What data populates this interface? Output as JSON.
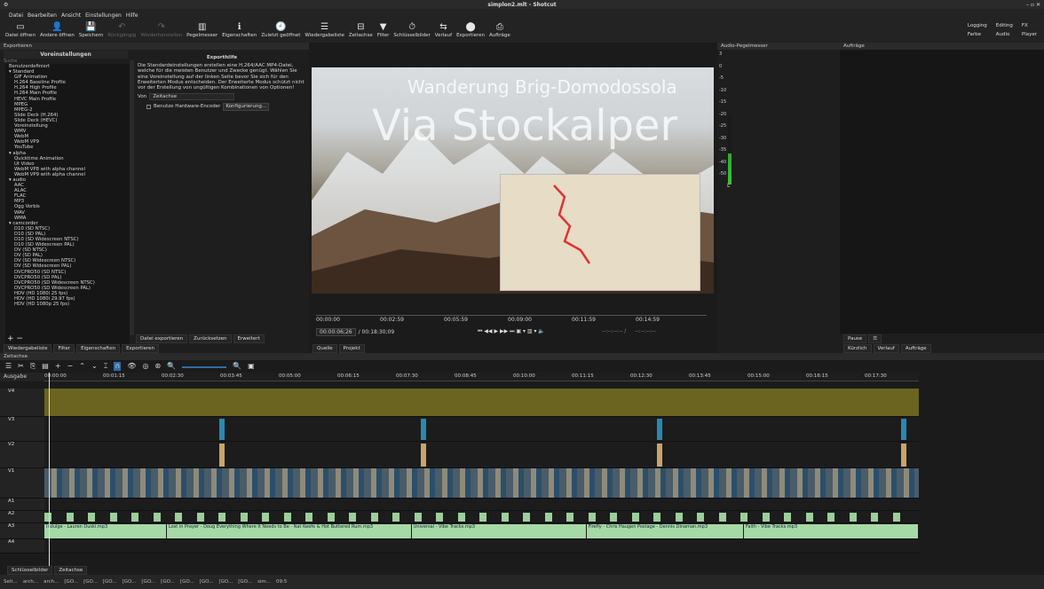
{
  "window": {
    "title": "simplon2.mlt - Shotcut",
    "left_glyph": "⚙",
    "controls": "– ▫ ✕"
  },
  "menu": [
    "Datei",
    "Bearbeiten",
    "Ansicht",
    "Einstellungen",
    "Hilfe"
  ],
  "toolbar": [
    {
      "icon": "▭",
      "label": "Datei öffnen"
    },
    {
      "icon": "👤",
      "label": "Andere öffnen"
    },
    {
      "icon": "💾",
      "label": "Speichern"
    },
    {
      "icon": "↶",
      "label": "Rückgängig",
      "dim": true
    },
    {
      "icon": "↷",
      "label": "Wiederherstellen",
      "dim": true
    },
    {
      "icon": "▥",
      "label": "Pegelmesser"
    },
    {
      "icon": "ℹ",
      "label": "Eigenschaften"
    },
    {
      "icon": "🕘",
      "label": "Zuletzt geöffnet"
    },
    {
      "icon": "☰",
      "label": "Wiedergabeliste"
    },
    {
      "icon": "⊟",
      "label": "Zeitachse"
    },
    {
      "icon": "▼",
      "label": "Filter"
    },
    {
      "icon": "⏱",
      "label": "Schlüsselbilder"
    },
    {
      "icon": "⇆",
      "label": "Verlauf"
    },
    {
      "icon": "⬤",
      "label": "Exportieren"
    },
    {
      "icon": "⎙",
      "label": "Aufträge"
    }
  ],
  "layouts": [
    "Logging",
    "Editing",
    "FX",
    "Farbe",
    "Audio",
    "Player"
  ],
  "export": {
    "panel_title": "Exportieren",
    "presets_title": "Voreinstellungen",
    "search_placeholder": "Suche",
    "presets": [
      "Benutzerdefiniert",
      "▾ Standard",
      "GIF Animation",
      "H.264 Baseline Profile",
      "H.264 High Profile",
      "H.264 Main Profile",
      "HEVC Main Profile",
      "MPEG",
      "MPEG-2",
      "Slide Deck (H.264)",
      "Slide Deck (HEVC)",
      "Voreinstellung",
      "WMV",
      "WebM",
      "WebM VP9",
      "YouTube",
      "▾ alpha",
      "Quicktime Animation",
      "Ut Video",
      "WebM VP8 with alpha channel",
      "WebM VP9 with alpha channel",
      "▾ audio",
      "AAC",
      "ALAC",
      "FLAC",
      "MP3",
      "Ogg Vorbis",
      "WAV",
      "WMA",
      "▾ camcorder",
      "D10 (SD NTSC)",
      "D10 (SD PAL)",
      "D10 (SD Widescreen NTSC)",
      "D10 (SD Widescreen PAL)",
      "DV (SD NTSC)",
      "DV (SD PAL)",
      "DV (SD Widescreen NTSC)",
      "DV (SD Widescreen PAL)",
      "DVCPRO50 (SD NTSC)",
      "DVCPRO50 (SD PAL)",
      "DVCPRO50 (SD Widescreen NTSC)",
      "DVCPRO50 (SD Widescreen PAL)",
      "HDV (HD 1080i 25 fps)",
      "HDV (HD 1080i 29.97 fps)",
      "HDV (HD 1080p 25 fps)"
    ],
    "help_title": "Exporthilfe",
    "help_text": "Die Standardeinstellungen erstellen eine H.264/AAC MP4-Datei, welche für die meisten Benutzer und Zwecke genügt. Wählen Sie eine Voreinstellung auf der linken Seite bevor Sie sich für den Erweiterten Modus entscheiden. Der Erweiterte Modus schützt nicht vor der Erstellung von ungültigen Kombinationen von Optionen!",
    "from_label": "Von",
    "from_value": "Zeitachse",
    "hw_label": "Benutze Hardware-Encoder",
    "config_button": "Konfigurierung...",
    "buttons": [
      "Datei exportieren",
      "Zurücksetzen",
      "Erweitert"
    ],
    "bottom_tabs": [
      "Wiedergabeliste",
      "Filter",
      "Eigenschaften",
      "Exportieren"
    ]
  },
  "player": {
    "title1": "Wanderung Brig-Domodossola",
    "title2": "Via Stockalper",
    "ruler": [
      "00:00:00",
      "00:02:59",
      "00:05:59",
      "00:09:00",
      "00:11:59",
      "00:14:59"
    ],
    "timecode": "00:00:06;26",
    "duration": "/ 00:18:30;09",
    "inout": "--:--:--:-- /",
    "inout2": "--:--:--:--",
    "tabs": [
      "Quelle",
      "Projekt"
    ]
  },
  "audiometer": {
    "title": "Audio-Pegelmesser",
    "scale": [
      "3",
      "0",
      "-5",
      "-10",
      "-15",
      "-20",
      "-25",
      "-30",
      "-35",
      "-40",
      "-50"
    ],
    "channels": [
      "L"
    ],
    "level_fraction": 0.45
  },
  "jobs": {
    "title": "Aufträge",
    "pause_label": "Pause",
    "tabs": [
      "Kürzlich",
      "Verlauf",
      "Aufträge"
    ]
  },
  "timeline": {
    "title": "Zeitachse",
    "output_label": "Ausgabe",
    "ruler": [
      "00:00:00",
      "00:01:15",
      "00:02:30",
      "00:03:45",
      "00:05:00",
      "00:06:15",
      "00:07:30",
      "00:08:45",
      "00:10:00",
      "00:11:15",
      "00:12:30",
      "00:13:45",
      "00:15:00",
      "00:16:15",
      "00:17:30"
    ],
    "tracks": [
      {
        "name": "V4",
        "kind": "video"
      },
      {
        "name": "V3",
        "kind": "video"
      },
      {
        "name": "V2",
        "kind": "video"
      },
      {
        "name": "V1",
        "kind": "video"
      },
      {
        "name": "A1",
        "kind": "audio"
      },
      {
        "name": "A2",
        "kind": "audio"
      },
      {
        "name": "A3",
        "kind": "audio"
      },
      {
        "name": "A4",
        "kind": "audio"
      }
    ],
    "a3_clips": [
      {
        "label": "Indulge - Lauren Duski.mp3",
        "start": 0.0,
        "end": 0.14
      },
      {
        "label": "Lost in Prayer - Doug Everything Where It Needs to Be - Nat Keefe & Hot Buttered Rum.mp3",
        "start": 0.14,
        "end": 0.42
      },
      {
        "label": "Universal - Vibe Tracks.mp3",
        "start": 0.42,
        "end": 0.62
      },
      {
        "label": "Firefly - Chris Haugen Postage - Dennis Dinaman.mp3",
        "start": 0.62,
        "end": 0.8
      },
      {
        "label": "Faith - Vibe Tracks.mp3",
        "start": 0.8,
        "end": 1.0
      }
    ],
    "bottom_tabs": [
      "Schlüsselbilder",
      "Zeitachse"
    ]
  },
  "status": [
    "Seit...",
    "arch...",
    "arch...",
    "[GO...",
    "[GO...",
    "[GO...",
    "[GO...",
    "[GO...",
    "[GO...",
    "[GO...",
    "[GO...",
    "[GO...",
    "[GO...",
    "sim...",
    "09:5"
  ]
}
